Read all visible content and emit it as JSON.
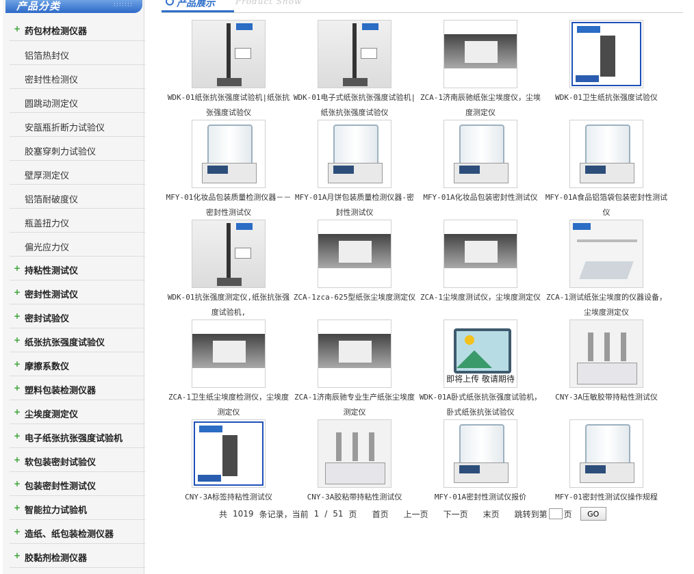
{
  "sidebar": {
    "title": "产品分类",
    "items": [
      {
        "label": "药包材检测仪器",
        "type": "cat"
      },
      {
        "label": "铝箔热封仪",
        "type": "sub"
      },
      {
        "label": "密封性检测仪",
        "type": "sub"
      },
      {
        "label": "圆跳动测定仪",
        "type": "sub"
      },
      {
        "label": "安瓿瓶折断力试验仪",
        "type": "sub"
      },
      {
        "label": "胶塞穿刺力试验仪",
        "type": "sub"
      },
      {
        "label": "壁厚测定仪",
        "type": "sub"
      },
      {
        "label": "铝箔耐破度仪",
        "type": "sub"
      },
      {
        "label": "瓶盖扭力仪",
        "type": "sub"
      },
      {
        "label": "偏光应力仪",
        "type": "sub"
      },
      {
        "label": "持粘性测试仪",
        "type": "cat"
      },
      {
        "label": "密封性测试仪",
        "type": "cat"
      },
      {
        "label": "密封试验仪",
        "type": "cat"
      },
      {
        "label": "纸张抗张强度试验仪",
        "type": "cat"
      },
      {
        "label": "摩擦系数仪",
        "type": "cat"
      },
      {
        "label": "塑料包装检测仪器",
        "type": "cat"
      },
      {
        "label": "尘埃度测定仪",
        "type": "cat"
      },
      {
        "label": "电子纸张抗张强度试验机",
        "type": "cat"
      },
      {
        "label": "软包装密封试验仪",
        "type": "cat"
      },
      {
        "label": "包装密封性测试仪",
        "type": "cat"
      },
      {
        "label": "智能拉力试验机",
        "type": "cat"
      },
      {
        "label": "造纸、纸包装检测仪器",
        "type": "cat"
      },
      {
        "label": "胶黏剂检测仪器",
        "type": "cat"
      }
    ]
  },
  "header": {
    "title": "产品展示",
    "subtitle": "Product Show"
  },
  "products": [
    {
      "name": "WDK-01纸张抗张强度试验机|纸张抗张强度试验仪",
      "thumb": "tall"
    },
    {
      "name": "WDK-01电子式纸张抗张强度试验机|纸张抗张强度试验仪",
      "thumb": "tall"
    },
    {
      "name": "ZCA-1济南辰驰纸张尘埃度仪，尘埃度测定仪",
      "thumb": "screen"
    },
    {
      "name": "WDK-01卫生纸抗张强度试验仪",
      "thumb": "framed"
    },
    {
      "name": "MFY-01化妆品包装质量检测仪器－－密封性测试仪",
      "thumb": "jar"
    },
    {
      "name": "MFY-01A月饼包装质量检测仪器-密封性测试仪",
      "thumb": "jar"
    },
    {
      "name": "MFY-01A化妆品包装密封性测试仪",
      "thumb": "jar"
    },
    {
      "name": "MFY-01A食品铝箔袋包装密封性测试仪",
      "thumb": "jar"
    },
    {
      "name": "WDK-01抗张强度测定仪,纸张抗张强度试验机,",
      "thumb": "tall"
    },
    {
      "name": "ZCA-1zca-625型纸张尘埃度测定仪",
      "thumb": "screen"
    },
    {
      "name": "ZCA-1尘埃度测试仪，尘埃度测定仪",
      "thumb": "screen"
    },
    {
      "name": "ZCA-1测试纸张尘埃度的仪器设备，尘埃度测定仪",
      "thumb": "plate"
    },
    {
      "name": "ZCA-1卫生纸尘埃度检测仪，尘埃度测定仪",
      "thumb": "screen"
    },
    {
      "name": "ZCA-1济南辰驰专业生产纸张尘埃度测定仪",
      "thumb": "screen"
    },
    {
      "name": "WDK-01A卧式纸张抗张强度试验机，卧式纸张抗张试验仪",
      "thumb": "placeholder"
    },
    {
      "name": "CNY-3A压敏胶带持粘性测试仪",
      "thumb": "tri"
    },
    {
      "name": "CNY-3A标签持粘性测试仪",
      "thumb": "framed"
    },
    {
      "name": "CNY-3A胶粘带持粘性测试仪",
      "thumb": "tri"
    },
    {
      "name": "MFY-01A密封性测试仪报价",
      "thumb": "jar"
    },
    {
      "name": "MFY-01密封性测试仪操作规程",
      "thumb": "jar"
    }
  ],
  "placeholder_text": "即将上传 敬请期待",
  "pagination": {
    "total_prefix": "共",
    "total": "1019",
    "records_label": "条记录，当前",
    "current": "1",
    "sep": "/",
    "pages": "51",
    "page_label": "页",
    "first": "首页",
    "prev": "上一页",
    "next": "下一页",
    "last": "末页",
    "jump_label": "跳转到第",
    "jump_suffix": "页",
    "go": "GO"
  }
}
